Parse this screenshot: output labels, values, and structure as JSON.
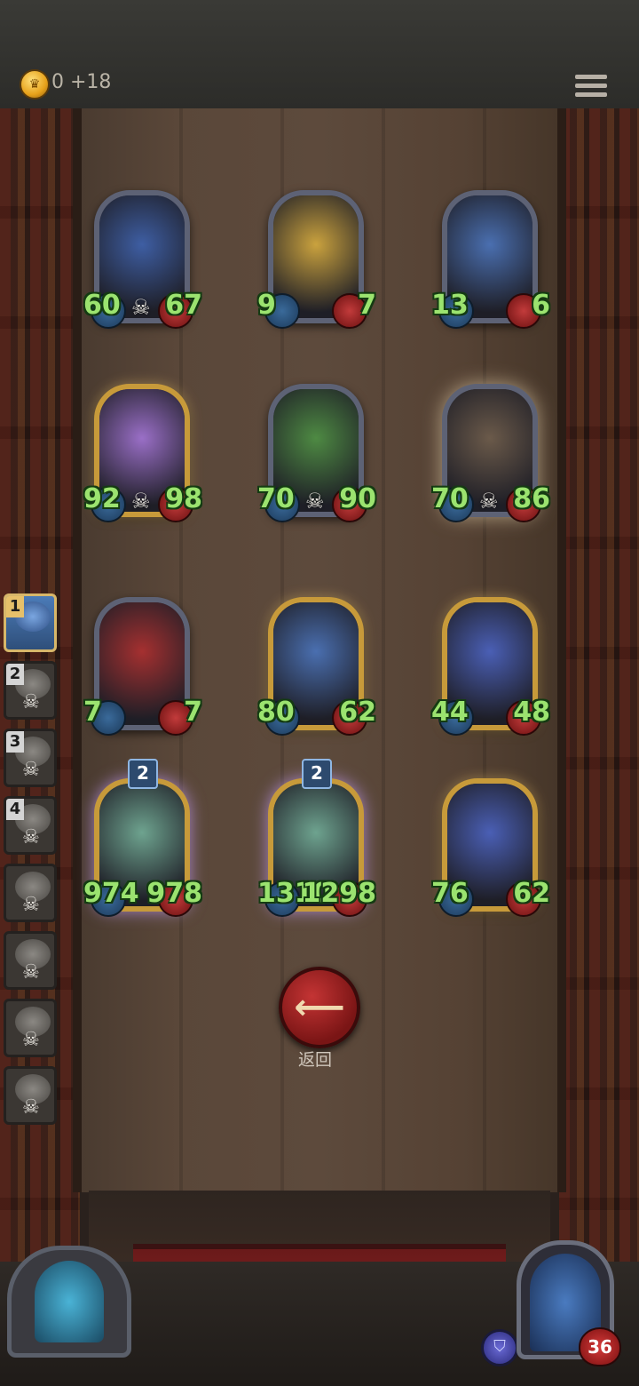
{
  "topbar": {
    "gold": "0 +18"
  },
  "cards": [
    {
      "atk": "60",
      "hp": "67",
      "style": "silver",
      "skull": true,
      "portrait": "#3e5ea3"
    },
    {
      "atk": "9",
      "hp": "7",
      "style": "silver",
      "skull": false,
      "portrait": "#caa23e"
    },
    {
      "atk": "13",
      "hp": "6",
      "style": "silver",
      "skull": false,
      "portrait": "#4a6fb0"
    },
    {
      "atk": "92",
      "hp": "98",
      "style": "gold",
      "skull": true,
      "portrait": "#9a6fc7"
    },
    {
      "atk": "70",
      "hp": "90",
      "style": "silver",
      "skull": true,
      "portrait": "#4e8a43"
    },
    {
      "atk": "70",
      "hp": "86",
      "style": "shine",
      "skull": true,
      "portrait": "#6b5a4a"
    },
    {
      "atk": "7",
      "hp": "7",
      "style": "silver",
      "skull": false,
      "portrait": "#a53030"
    },
    {
      "atk": "80",
      "hp": "62",
      "style": "gold",
      "skull": false,
      "portrait": "#4a6fb0"
    },
    {
      "atk": "44",
      "hp": "48",
      "style": "gold",
      "skull": false,
      "portrait": "#4a5fb5"
    },
    {
      "atk": "974",
      "hp": "978",
      "style": "purple",
      "skull": false,
      "portrait": "#6ea38f",
      "level": "2"
    },
    {
      "atk": "1310",
      "hp": "1298",
      "style": "purple",
      "skull": false,
      "portrait": "#6ea38f",
      "level": "2"
    },
    {
      "atk": "76",
      "hp": "62",
      "style": "gold",
      "skull": false,
      "portrait": "#4a5fb5"
    }
  ],
  "back_button": {
    "label": "返回"
  },
  "queue": [
    {
      "num": "1",
      "active": true
    },
    {
      "num": "2",
      "active": false
    },
    {
      "num": "3",
      "active": false
    },
    {
      "num": "4",
      "active": false
    },
    {
      "num": "",
      "active": false
    },
    {
      "num": "",
      "active": false
    },
    {
      "num": "",
      "active": false
    },
    {
      "num": "",
      "active": false
    }
  ],
  "player": {
    "hp": "36"
  }
}
